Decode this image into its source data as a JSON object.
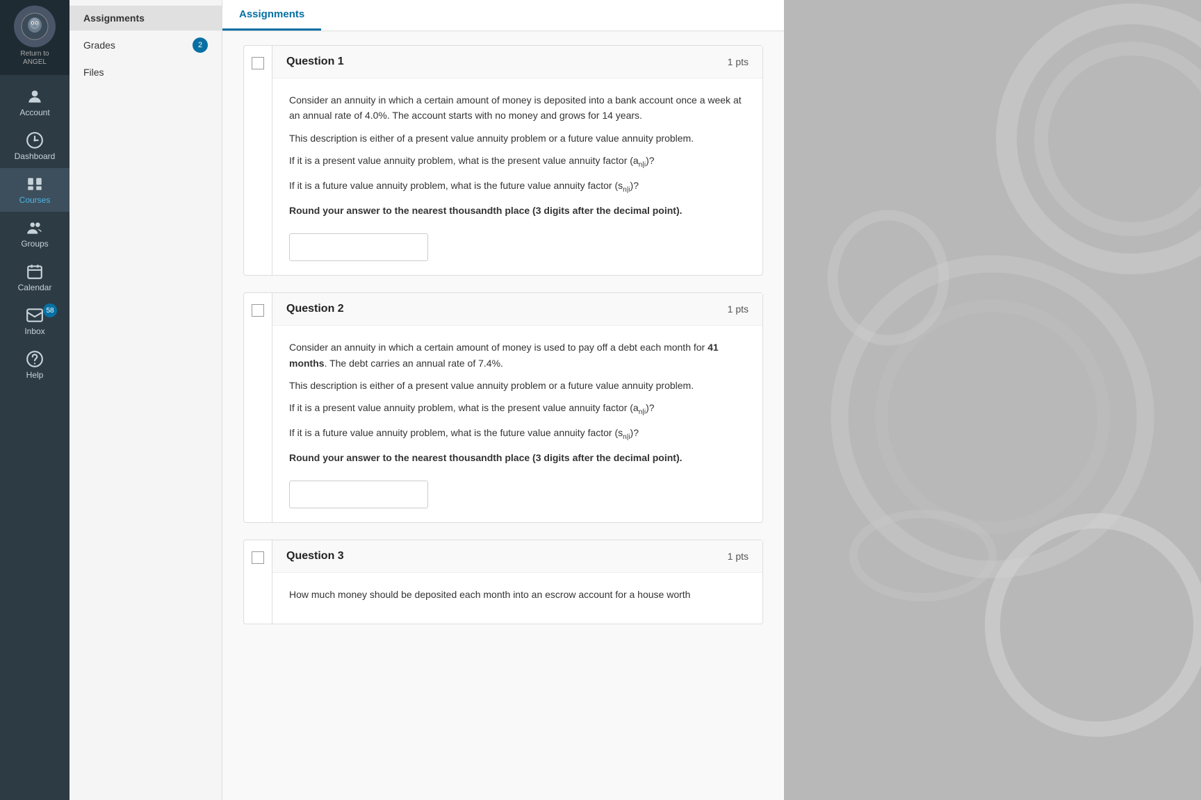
{
  "sidebar": {
    "return_label": "Return to\nANGEL",
    "items": [
      {
        "id": "account",
        "label": "Account",
        "icon": "account-icon"
      },
      {
        "id": "dashboard",
        "label": "Dashboard",
        "icon": "dashboard-icon"
      },
      {
        "id": "courses",
        "label": "Courses",
        "icon": "courses-icon",
        "active": true
      },
      {
        "id": "groups",
        "label": "Groups",
        "icon": "groups-icon"
      },
      {
        "id": "calendar",
        "label": "Calendar",
        "icon": "calendar-icon"
      },
      {
        "id": "inbox",
        "label": "Inbox",
        "icon": "inbox-icon",
        "badge": "58"
      },
      {
        "id": "help",
        "label": "Help",
        "icon": "help-icon"
      }
    ]
  },
  "course_nav": {
    "items": [
      {
        "id": "assignments",
        "label": "Assignments",
        "active": true
      },
      {
        "id": "grades",
        "label": "Grades",
        "badge": "2"
      },
      {
        "id": "files",
        "label": "Files"
      }
    ]
  },
  "main": {
    "active_tab": "Assignments",
    "questions": [
      {
        "id": "q1",
        "title": "Question 1",
        "pts": "1 pts",
        "paragraphs": [
          "Consider an annuity in which a certain amount of money is deposited into a bank account once a week at an annual rate of 4.0%. The account starts with no money and grows for 14 years.",
          "This description is either of a present value annuity problem or a future value annuity problem.",
          "If it is a present value annuity problem, what is the present value annuity factor (a_n|i)?",
          "If it is a future value annuity problem, what is the future value annuity factor (s_n|i)?",
          "Round your answer to the nearest thousandth place (3 digits after the decimal point)."
        ],
        "bold_paragraph_index": 4
      },
      {
        "id": "q2",
        "title": "Question 2",
        "pts": "1 pts",
        "paragraphs": [
          "Consider an annuity in which a certain amount of money is used to pay off a debt each month for 41 months. The debt carries an annual rate of 7.4%.",
          "This description is either of a present value annuity problem or a future value annuity problem.",
          "If it is a present value annuity problem, what is the present value annuity factor (a_n|i)?",
          "If it is a future value annuity problem, what is the future value annuity factor (s_n|i)?",
          "Round your answer to the nearest thousandth place (3 digits after the decimal point)."
        ],
        "bold_paragraph_index": 4
      },
      {
        "id": "q3",
        "title": "Question 3",
        "pts": "1 pts",
        "paragraphs": [
          "How much money should be deposited each month into an escrow account for a house worth"
        ],
        "bold_paragraph_index": -1
      }
    ]
  }
}
